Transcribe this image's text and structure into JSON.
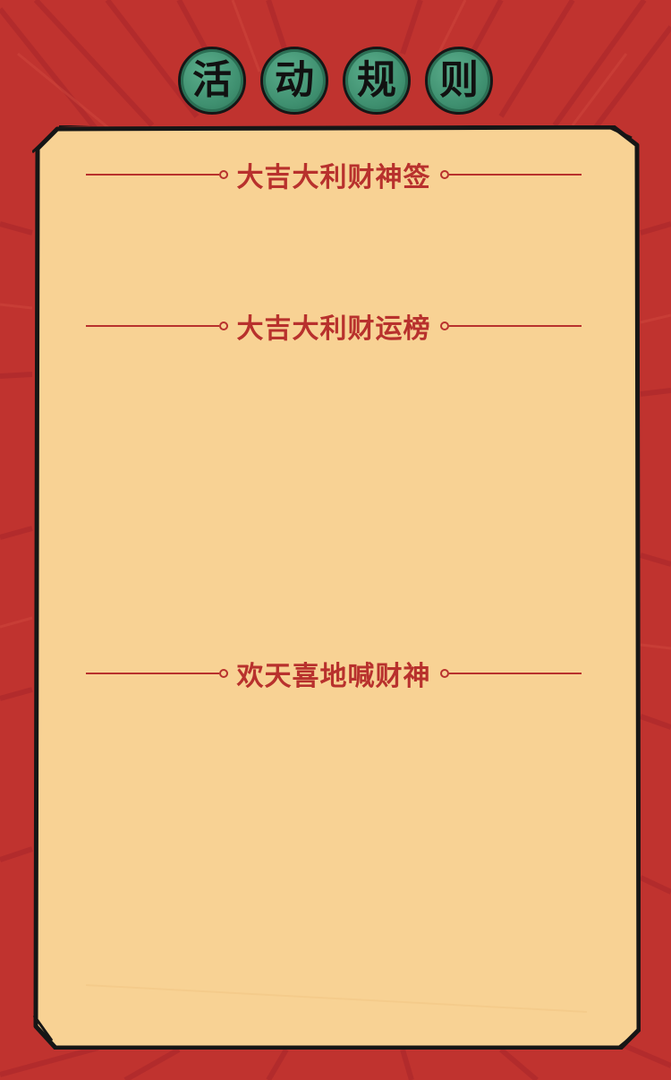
{
  "title": {
    "chars": [
      "活",
      "动",
      "规",
      "则"
    ]
  },
  "sections": [
    {
      "heading": "大吉大利财神签"
    },
    {
      "heading": "大吉大利财运榜"
    },
    {
      "heading": "欢天喜地喊财神"
    }
  ],
  "colors": {
    "background_red": "#c0332f",
    "paper": "#f8d294",
    "heading_red": "#b8312d",
    "badge_green": "#3f9070",
    "outline": "#161616"
  }
}
